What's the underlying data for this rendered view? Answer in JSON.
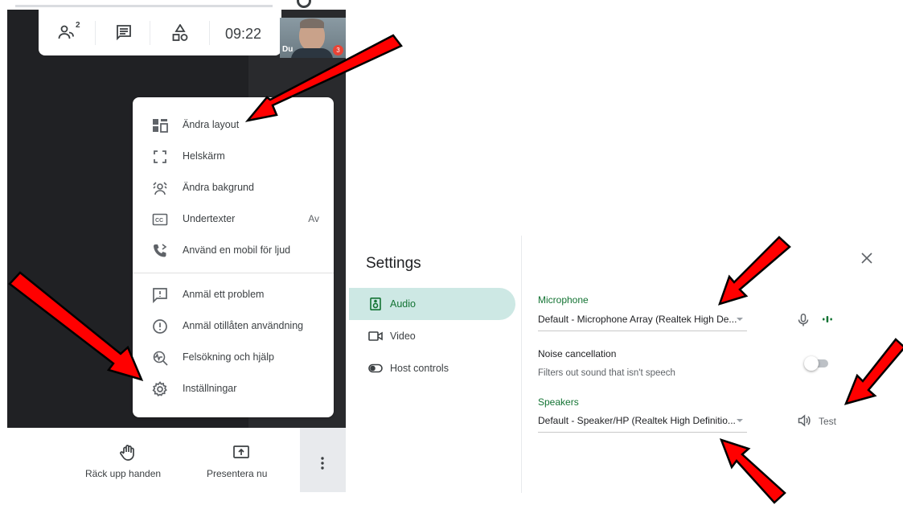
{
  "meet": {
    "people_count": "2",
    "time": "09:22",
    "self_label": "Du",
    "self_badge": "3",
    "menu": {
      "items": [
        {
          "label": "Ändra layout",
          "icon": "layout-icon"
        },
        {
          "label": "Helskärm",
          "icon": "fullscreen-icon"
        },
        {
          "label": "Ändra bakgrund",
          "icon": "background-icon"
        },
        {
          "label": "Undertexter",
          "icon": "captions-icon",
          "value": "Av"
        },
        {
          "label": "Använd en mobil för ljud",
          "icon": "phone-audio-icon"
        },
        {
          "label": "Anmäl ett problem",
          "icon": "report-problem-icon"
        },
        {
          "label": "Anmäl otillåten användning",
          "icon": "report-abuse-icon"
        },
        {
          "label": "Felsökning och hjälp",
          "icon": "troubleshoot-icon"
        },
        {
          "label": "Inställningar",
          "icon": "settings-gear-icon"
        }
      ]
    },
    "bottom": {
      "raise_hand": "Räck upp handen",
      "present_now": "Presentera nu"
    }
  },
  "settings": {
    "title": "Settings",
    "nav": [
      {
        "label": "Audio",
        "icon": "speaker-box-icon",
        "active": true
      },
      {
        "label": "Video",
        "icon": "camera-icon",
        "active": false
      },
      {
        "label": "Host controls",
        "icon": "toggle-icon",
        "active": false
      }
    ],
    "microphone": {
      "label": "Microphone",
      "value": "Default - Microphone Array (Realtek High De..."
    },
    "noise": {
      "title": "Noise cancellation",
      "description": "Filters out sound that isn't speech",
      "enabled": false
    },
    "speakers": {
      "label": "Speakers",
      "value": "Default - Speaker/HP (Realtek High Definitio...",
      "test_label": "Test"
    }
  },
  "colors": {
    "accent_green": "#137333",
    "nav_active_bg": "#cde8e4",
    "meet_dark": "#202124",
    "annotation_arrow": "#ff0000"
  }
}
